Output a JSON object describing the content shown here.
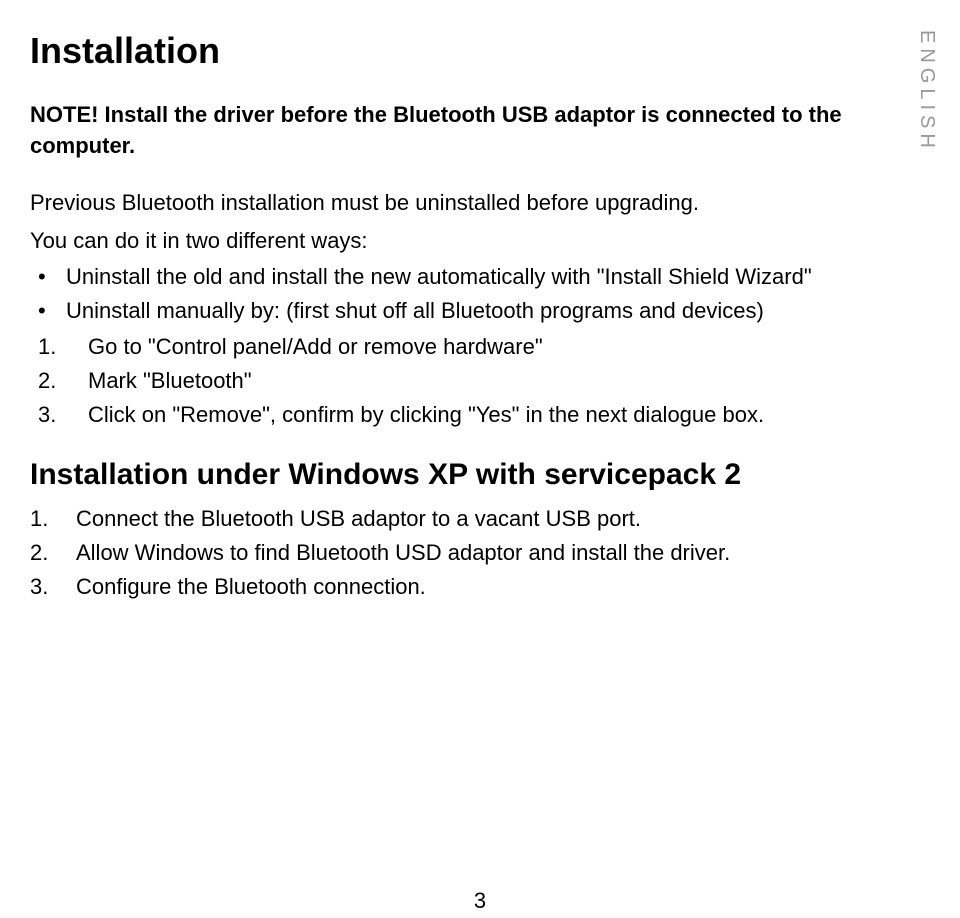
{
  "sideLabel": "ENGLISH",
  "pageNumber": "3",
  "title": "Installation",
  "note": "NOTE! Install the driver before the Bluetooth USB adaptor is connected to the computer.",
  "intro1": "Previous Bluetooth installation must be uninstalled before upgrading.",
  "intro2": "You can do it in two different ways:",
  "bullets": [
    "Uninstall the old and install the new automatically with \"Install Shield Wizard\"",
    "Uninstall manually by: (first shut off all Bluetooth programs and devices)"
  ],
  "innerSteps": [
    {
      "num": "1.",
      "text": "Go to \"Control panel/Add or remove hardware\""
    },
    {
      "num": "2.",
      "text": "Mark \"Bluetooth\""
    },
    {
      "num": "3.",
      "text": "Click on \"Remove\", confirm by clicking \"Yes\" in the next dialogue box."
    }
  ],
  "section2Heading": "Installation under Windows XP with servicepack 2",
  "section2Steps": [
    {
      "num": "1.",
      "text": "Connect the Bluetooth USB adaptor to a vacant USB port."
    },
    {
      "num": "2.",
      "text": "Allow Windows to find Bluetooth USD adaptor and install the driver."
    },
    {
      "num": "3.",
      "text": "Configure the Bluetooth connection."
    }
  ]
}
